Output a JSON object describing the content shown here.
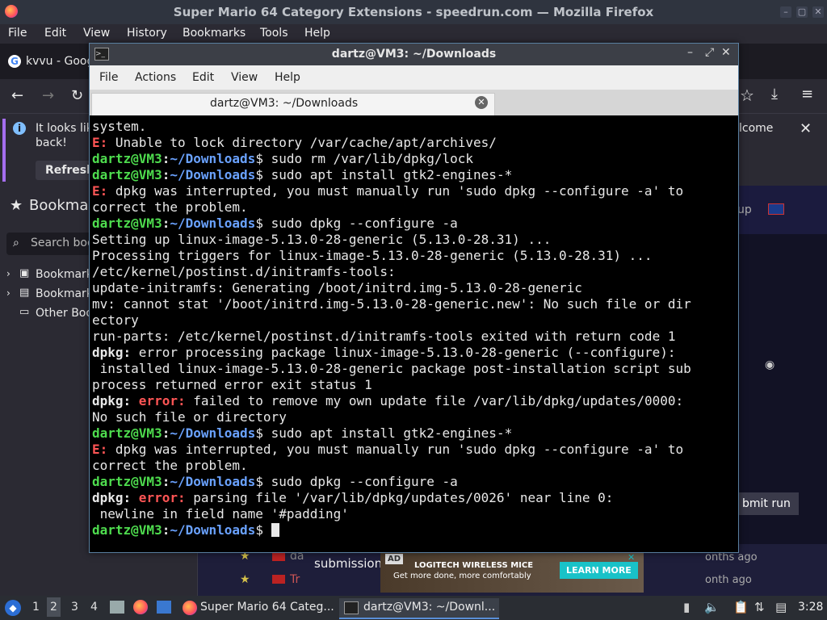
{
  "firefox": {
    "title": "Super Mario 64 Category Extensions - speedrun.com — Mozilla Firefox",
    "menu": [
      "File",
      "Edit",
      "View",
      "History",
      "Bookmarks",
      "Tools",
      "Help"
    ],
    "tab_label": "kvvu - Goog",
    "notice_text_line1": "It looks lik",
    "notice_text_line2": "back!",
    "notice_right": "lcome",
    "notice_button": "Refresh",
    "sidebar_title": "Bookma",
    "sidebar_search_placeholder": "Search boo",
    "sidebar_items": [
      "Bookmark",
      "Bookmark",
      "Other Boo"
    ],
    "page_up": "up",
    "page_submit": "bmit run",
    "page_submission": "submission",
    "page_rows": [
      {
        "ago": "onths ago",
        "name": "da"
      },
      {
        "ago": "onth ago",
        "name": "Tr"
      }
    ],
    "ad": {
      "badge": "AD",
      "brand": "LOGITECH WIRELESS MICE",
      "tag": "Get more done, more comfortably",
      "cta": "LEARN MORE"
    }
  },
  "terminal": {
    "title": "dartz@VM3: ~/Downloads",
    "menu": [
      "File",
      "Actions",
      "Edit",
      "View",
      "Help"
    ],
    "tab_title": "dartz@VM3: ~/Downloads",
    "prompt_user": "dartz@VM3",
    "prompt_path": "~/Downloads",
    "lines": {
      "l1": "system.",
      "l2e": "E:",
      "l2": " Unable to lock directory /var/cache/apt/archives/",
      "c1": " sudo rm /var/lib/dpkg/lock",
      "c2": " sudo apt install gtk2-engines-*",
      "l5e": "E:",
      "l5": " dpkg was interrupted, you must manually run 'sudo dpkg --configure -a' to",
      "l6": "correct the problem.",
      "c3": " sudo dpkg --configure -a",
      "l8": "Setting up linux-image-5.13.0-28-generic (5.13.0-28.31) ...",
      "l9": "Processing triggers for linux-image-5.13.0-28-generic (5.13.0-28.31) ...",
      "l10": "/etc/kernel/postinst.d/initramfs-tools:",
      "l11": "update-initramfs: Generating /boot/initrd.img-5.13.0-28-generic",
      "l12": "mv: cannot stat '/boot/initrd.img-5.13.0-28-generic.new': No such file or dir",
      "l13": "ectory",
      "l14": "run-parts: /etc/kernel/postinst.d/initramfs-tools exited with return code 1",
      "l15b": "dpkg:",
      "l15": " error processing package linux-image-5.13.0-28-generic (--configure):",
      "l16": " installed linux-image-5.13.0-28-generic package post-installation script sub",
      "l17": "process returned error exit status 1",
      "l18b": "dpkg:",
      "l18e": " error:",
      "l18": " failed to remove my own update file /var/lib/dpkg/updates/0000:",
      "l19": "No such file or directory",
      "c4": " sudo apt install gtk2-engines-*",
      "l21e": "E:",
      "l21": " dpkg was interrupted, you must manually run 'sudo dpkg --configure -a' to",
      "l22": "correct the problem.",
      "c5": " sudo dpkg --configure -a",
      "l24b": "dpkg:",
      "l24e": " error:",
      "l24": " parsing file '/var/lib/dpkg/updates/0026' near line 0:",
      "l25": " newline in field name '#padding'"
    }
  },
  "taskbar": {
    "workspaces": [
      "1",
      "2",
      "3",
      "4"
    ],
    "active_workspace": "2",
    "task1": "Super Mario 64 Categ...",
    "task2": "dartz@VM3: ~/Downl...",
    "clock": "3:28"
  },
  "colors": {
    "prompt_user": "#4edc4e",
    "prompt_path": "#6aa2ff",
    "error": "#ff5555"
  }
}
